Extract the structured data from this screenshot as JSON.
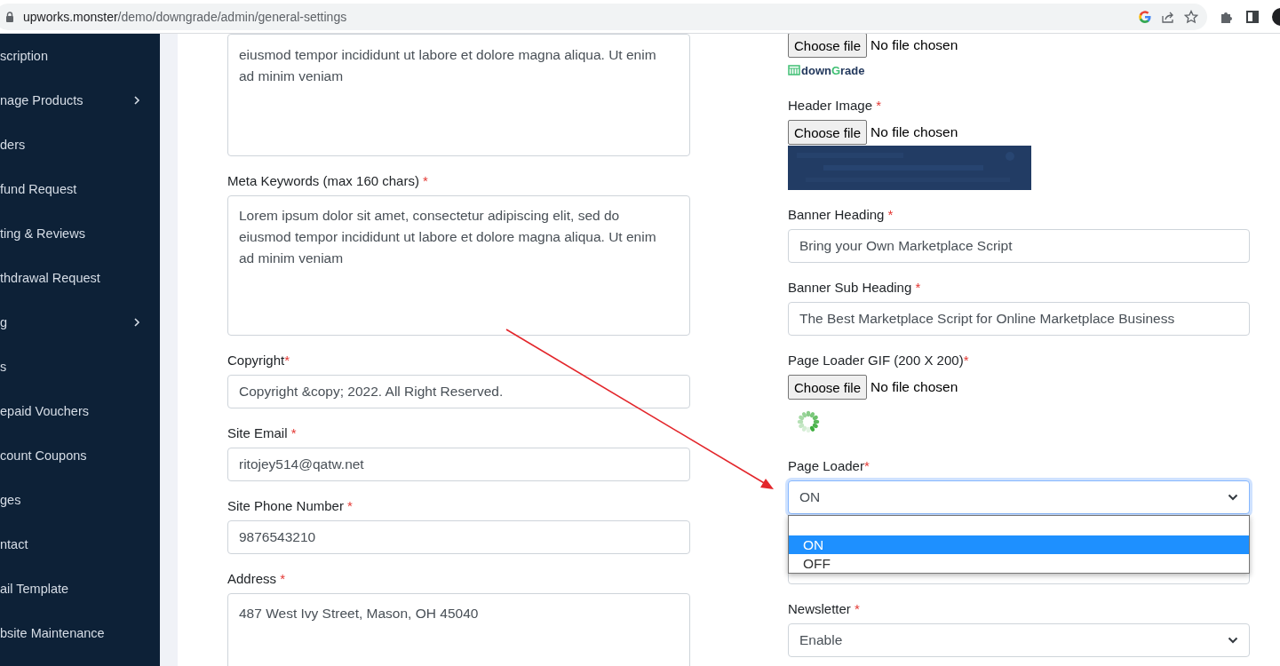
{
  "browser": {
    "url_host": "upworks.monster",
    "url_path": "/demo/downgrade/admin/general-settings"
  },
  "sidebar": {
    "items": [
      {
        "label": "scription",
        "expandable": false
      },
      {
        "label": "nage Products",
        "expandable": true
      },
      {
        "label": "ders",
        "expandable": false
      },
      {
        "label": "fund Request",
        "expandable": false
      },
      {
        "label": "ting & Reviews",
        "expandable": false
      },
      {
        "label": "thdrawal Request",
        "expandable": false
      },
      {
        "label": "g",
        "expandable": true
      },
      {
        "label": "s",
        "expandable": false
      },
      {
        "label": "epaid Vouchers",
        "expandable": false
      },
      {
        "label": "count Coupons",
        "expandable": false
      },
      {
        "label": "ges",
        "expandable": false
      },
      {
        "label": "ntact",
        "expandable": false
      },
      {
        "label": "ail Template",
        "expandable": false
      },
      {
        "label": "bsite Maintenance",
        "expandable": false
      }
    ]
  },
  "left_fields": [
    {
      "kind": "textarea_cut",
      "value": "eiusmod tempor incididunt ut labore et dolore magna aliqua. Ut enim ad minim veniam"
    },
    {
      "kind": "textarea",
      "label": "Meta Keywords (max 160 chars)",
      "required_mark": "*",
      "mark_spaced": true,
      "value": "Lorem ipsum dolor sit amet, consectetur adipiscing elit, sed do eiusmod tempor incididunt ut labore et dolore magna aliqua. Ut enim ad minim veniam"
    },
    {
      "kind": "input",
      "label": "Copyright",
      "required_mark": "*",
      "mark_spaced": false,
      "value": "Copyright &copy; 2022. All Right Reserved."
    },
    {
      "kind": "input",
      "label": "Site Email",
      "required_mark": "*",
      "mark_spaced": true,
      "value": "ritojey514@qatw.net"
    },
    {
      "kind": "input",
      "label": "Site Phone Number",
      "required_mark": "*",
      "mark_spaced": true,
      "value": "9876543210"
    },
    {
      "kind": "textarea",
      "label": "Address",
      "required_mark": "*",
      "mark_spaced": true,
      "value": "487 West Ivy Street, Mason, OH 45040"
    }
  ],
  "right_fields": [
    {
      "kind": "file",
      "button": "Choose file",
      "status": "No file chosen"
    },
    {
      "kind": "logo",
      "text_start": "down",
      "text_accent": "G",
      "text_end": "rade"
    },
    {
      "kind": "file",
      "label": "Header Image",
      "required_mark": "*",
      "mark_spaced": true,
      "button": "Choose file",
      "status": "No file chosen"
    },
    {
      "kind": "banner"
    },
    {
      "kind": "input",
      "label": "Banner Heading",
      "required_mark": "*",
      "mark_spaced": true,
      "value": "Bring your Own Marketplace Script"
    },
    {
      "kind": "input",
      "label": "Banner Sub Heading",
      "required_mark": "*",
      "mark_spaced": true,
      "value": "The Best Marketplace Script for Online Marketplace Business"
    },
    {
      "kind": "file",
      "label": "Page Loader GIF (200 X 200)",
      "required_mark": "*",
      "mark_spaced": false,
      "button": "Choose file",
      "status": "No file chosen"
    },
    {
      "kind": "spinner"
    },
    {
      "kind": "select",
      "label": "Page Loader",
      "required_mark": "*",
      "mark_spaced": false,
      "value": "ON",
      "open": true,
      "options": [
        {
          "selected": false
        },
        {
          "label": "ON",
          "selected": true
        },
        {
          "label": "OFF",
          "selected": false
        }
      ]
    },
    {
      "kind": "covered"
    },
    {
      "kind": "select",
      "label": "Newsletter",
      "required_mark": "*",
      "mark_spaced": true,
      "value": "Enable",
      "open": false
    }
  ]
}
